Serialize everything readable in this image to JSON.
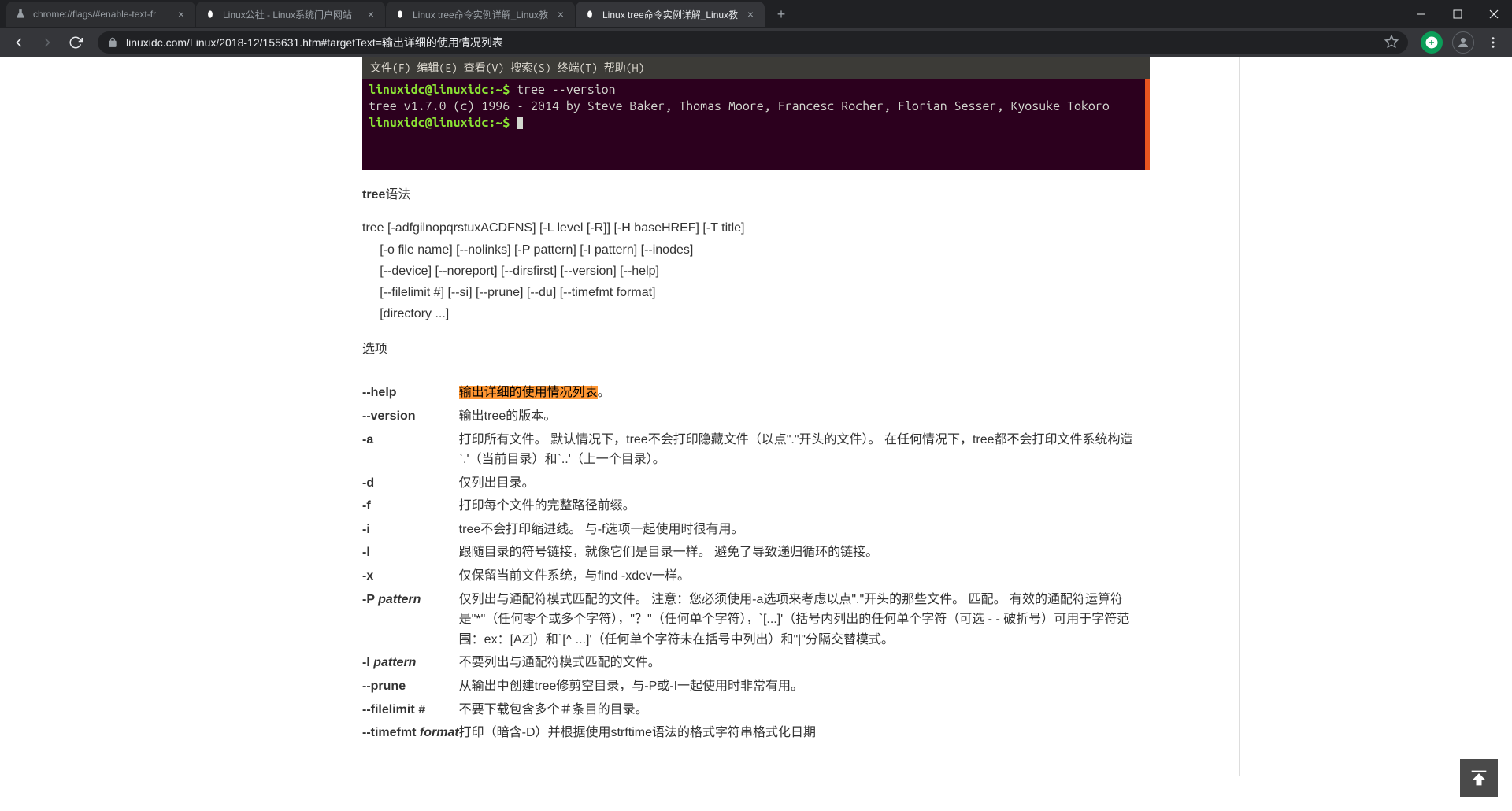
{
  "browser": {
    "tabs": [
      {
        "title": "chrome://flags/#enable-text-fr",
        "favicon": "flask"
      },
      {
        "title": "Linux公社 - Linux系统门户网站",
        "favicon": "tux"
      },
      {
        "title": "Linux tree命令实例详解_Linux教",
        "favicon": "tux"
      },
      {
        "title": "Linux tree命令实例详解_Linux教",
        "favicon": "tux",
        "active": true
      }
    ],
    "url": "linuxidc.com/Linux/2018-12/155631.htm#targetText=输出详细的使用情况列表"
  },
  "terminal": {
    "menu": "文件(F)  编辑(E)  查看(V)  搜索(S)  终端(T)  帮助(H)",
    "prompt": "linuxidc@linuxidc:~$",
    "cmd": " tree --version",
    "output": "tree v1.7.0 (c) 1996 - 2014 by Steve Baker, Thomas Moore, Francesc Rocher, Florian Sesser, Kyosuke Tokoro"
  },
  "syntax": {
    "title_strong": "tree",
    "title_rest": "语法",
    "lines": [
      "tree [-adfgilnopqrstuxACDFNS] [-L level [-R]] [-H baseHREF] [-T title]",
      "     [-o file name] [--nolinks] [-P pattern] [-I pattern] [--inodes]",
      "     [--device] [--noreport] [--dirsfirst] [--version] [--help]",
      "     [--filelimit #] [--si] [--prune] [--du] [--timefmt format]",
      "     [directory ...]"
    ]
  },
  "options_title": "选项",
  "options": [
    {
      "name": "--help",
      "desc_hl": "输出详细的使用情况列表",
      "desc_after": "。"
    },
    {
      "name": "--version",
      "desc": "输出tree的版本。"
    },
    {
      "name": "-a",
      "desc": "打印所有文件。 默认情况下，tree不会打印隐藏文件（以点\".\"开头的文件）。 在任何情况下，tree都不会打印文件系统构造`.'（当前目录）和`..'（上一个目录）。"
    },
    {
      "name": "-d",
      "desc": "仅列出目录。"
    },
    {
      "name": "-f",
      "desc": "打印每个文件的完整路径前缀。"
    },
    {
      "name": "-i",
      "desc": "tree不会打印缩进线。 与-f选项一起使用时很有用。"
    },
    {
      "name": "-l",
      "desc": "跟随目录的符号链接，就像它们是目录一样。 避免了导致递归循环的链接。"
    },
    {
      "name": "-x",
      "desc": "仅保留当前文件系统，与find -xdev一样。"
    },
    {
      "name": "-P ",
      "name_em": "pattern",
      "desc": "仅列出与通配符模式匹配的文件。 注意：您必须使用-a选项来考虑以点\".\"开头的那些文件。 匹配。 有效的通配符运算符是\"*\"（任何零个或多个字符），\"？\"（任何单个字符），`[...]'（括号内列出的任何单个字符（可选 -  - 破折号）可用于字符范围：ex：[AZ]）和`[^ ...]'（任何单个字符未在括号中列出）和\"|\"分隔交替模式。"
    },
    {
      "name": "-I ",
      "name_em": "pattern",
      "desc": "不要列出与通配符模式匹配的文件。"
    },
    {
      "name": "--prune",
      "desc": "从输出中创建tree修剪空目录，与-P或-I一起使用时非常有用。"
    },
    {
      "name": "--filelimit ",
      "name_em": "#",
      "desc": "不要下载包含多个＃条目的目录。"
    },
    {
      "name": "--timefmt ",
      "name_em": "format",
      "desc": "打印（暗含-D）并根据使用strftime语法的格式字符串格式化日期"
    }
  ]
}
